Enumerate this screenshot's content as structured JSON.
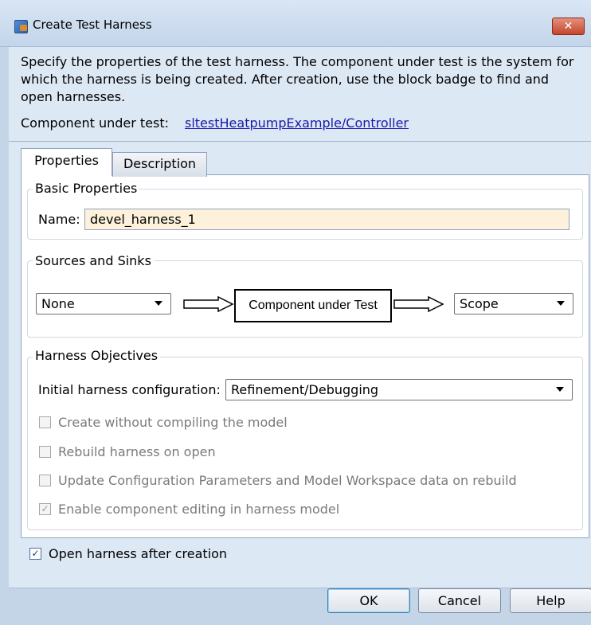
{
  "window": {
    "title": "Create Test Harness",
    "close_glyph": "✕"
  },
  "header": {
    "description": "Specify the properties of the test harness. The component under test is the system for which the harness is being created. After creation, use the block badge to find and open harnesses.",
    "component_label": "Component under test:",
    "component_link": "sltestHeatpumpExample/Controller"
  },
  "tabs": [
    {
      "label": "Properties",
      "active": true
    },
    {
      "label": "Description",
      "active": false
    }
  ],
  "basic_properties": {
    "title": "Basic Properties",
    "name_label": "Name:",
    "name_value": "devel_harness_1"
  },
  "sources_sinks": {
    "title": "Sources and Sinks",
    "source_value": "None",
    "component_box": "Component under Test",
    "sink_value": "Scope"
  },
  "objectives": {
    "title": "Harness Objectives",
    "config_label": "Initial harness configuration:",
    "config_value": "Refinement/Debugging",
    "options": [
      {
        "label": "Create without compiling the model",
        "checked": false,
        "enabled": false
      },
      {
        "label": "Rebuild harness on open",
        "checked": false,
        "enabled": false
      },
      {
        "label": "Update Configuration Parameters and Model Workspace data on rebuild",
        "checked": false,
        "enabled": false
      },
      {
        "label": "Enable component editing in harness model",
        "checked": true,
        "enabled": false
      }
    ]
  },
  "open_after": {
    "label": "Open harness after creation",
    "checked": true
  },
  "buttons": {
    "ok": "OK",
    "cancel": "Cancel",
    "help": "Help"
  },
  "colors": {
    "input_highlight": "#fdf1dc",
    "link": "#1a1aaa",
    "dialog_bg": "#dde8f5"
  }
}
